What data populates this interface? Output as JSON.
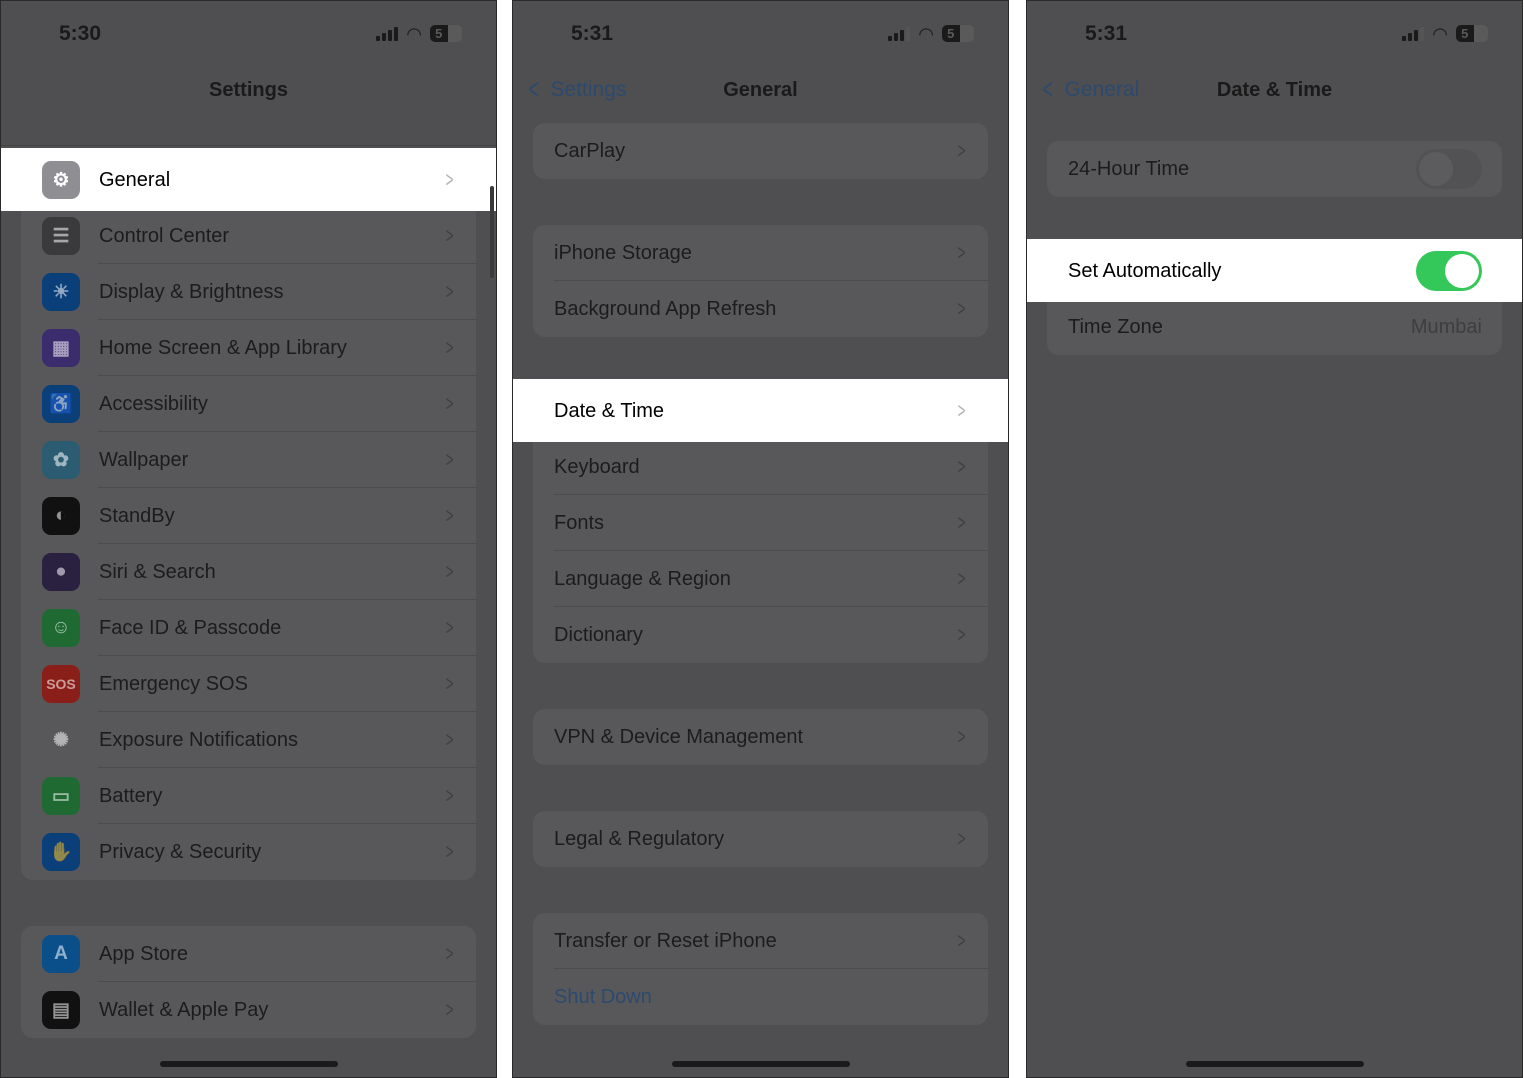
{
  "panels": [
    {
      "status": {
        "time": "5:30",
        "battery": "5"
      },
      "nav": {
        "title": "Settings",
        "back": ""
      },
      "groups": [
        {
          "rows": [
            {
              "label": "General",
              "icon": "gear-icon",
              "glyph": "⚙",
              "color": "#8e8e93",
              "highlighted": true
            },
            {
              "label": "Control Center",
              "icon": "switches-icon",
              "glyph": "☰",
              "color": "#3a3a3c"
            },
            {
              "label": "Display & Brightness",
              "icon": "sun-icon",
              "glyph": "☀",
              "color": "#0a3f7a"
            },
            {
              "label": "Home Screen & App Library",
              "icon": "app-grid-icon",
              "glyph": "▦",
              "color": "#3b2c6e"
            },
            {
              "label": "Accessibility",
              "icon": "accessibility-icon",
              "glyph": "♿",
              "color": "#0a3f7a"
            },
            {
              "label": "Wallpaper",
              "icon": "flower-icon",
              "glyph": "✿",
              "color": "#2c5c72"
            },
            {
              "label": "StandBy",
              "icon": "standby-icon",
              "glyph": "◐",
              "color": "#111111"
            },
            {
              "label": "Siri & Search",
              "icon": "siri-icon",
              "glyph": "●",
              "color": "#2a2040"
            },
            {
              "label": "Face ID & Passcode",
              "icon": "face-id-icon",
              "glyph": "☺",
              "color": "#1f6a33"
            },
            {
              "label": "Emergency SOS",
              "icon": "sos-icon",
              "glyph": "SOS",
              "color": "#8a1f1a"
            },
            {
              "label": "Exposure Notifications",
              "icon": "exposure-icon",
              "glyph": "✺",
              "color": "#58585b"
            },
            {
              "label": "Battery",
              "icon": "battery-icon",
              "glyph": "▭",
              "color": "#1f6a33"
            },
            {
              "label": "Privacy & Security",
              "icon": "hand-icon",
              "glyph": "✋",
              "color": "#0a3f7a"
            }
          ]
        },
        {
          "rows": [
            {
              "label": "App Store",
              "icon": "app-store-icon",
              "glyph": "A",
              "color": "#0a4f8a"
            },
            {
              "label": "Wallet & Apple Pay",
              "icon": "wallet-icon",
              "glyph": "▤",
              "color": "#111111"
            }
          ]
        }
      ]
    },
    {
      "status": {
        "time": "5:31",
        "battery": "5"
      },
      "nav": {
        "title": "General",
        "back": "Settings"
      },
      "groups": [
        {
          "rows": [
            {
              "label": "CarPlay"
            }
          ]
        },
        {
          "rows": [
            {
              "label": "iPhone Storage"
            },
            {
              "label": "Background App Refresh"
            }
          ]
        },
        {
          "rows": [
            {
              "label": "Date & Time",
              "highlighted": true
            },
            {
              "label": "Keyboard"
            },
            {
              "label": "Fonts"
            },
            {
              "label": "Language & Region"
            },
            {
              "label": "Dictionary"
            }
          ]
        },
        {
          "rows": [
            {
              "label": "VPN & Device Management"
            }
          ]
        },
        {
          "rows": [
            {
              "label": "Legal & Regulatory"
            }
          ]
        },
        {
          "rows": [
            {
              "label": "Transfer or Reset iPhone"
            },
            {
              "label": "Shut Down",
              "link": true,
              "nochevron": true
            }
          ]
        }
      ]
    },
    {
      "status": {
        "time": "5:31",
        "battery": "5"
      },
      "nav": {
        "title": "Date & Time",
        "back": "General"
      },
      "groups": [
        {
          "rows": [
            {
              "label": "24-Hour Time",
              "toggle": false
            }
          ]
        },
        {
          "rows": [
            {
              "label": "Set Automatically",
              "toggle": true,
              "highlighted": true
            },
            {
              "label": "Time Zone",
              "value": "Mumbai",
              "nochevron": true
            }
          ]
        }
      ]
    }
  ],
  "colors": {
    "toggle_on": "#34c759",
    "link": "#2c4a6e",
    "highlight": "#ffffff"
  }
}
